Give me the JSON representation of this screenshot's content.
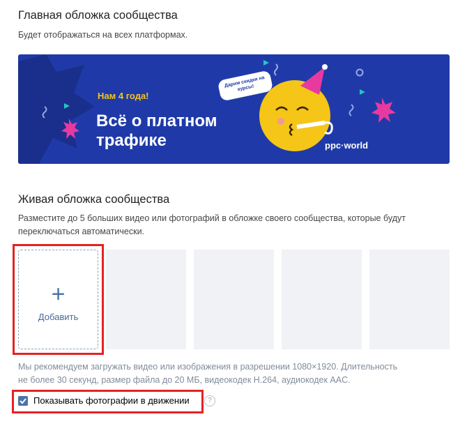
{
  "main_cover": {
    "title": "Главная обложка сообщества",
    "description": "Будет отображаться на всех платформах.",
    "banner": {
      "badge": "Нам 4 года!",
      "headline": "Всё о платном трафике",
      "sticker": "Дарим скидки на курсы!",
      "brand": "ppc·world",
      "colors": {
        "background": "#1f3aa8",
        "accent": "#f5c518",
        "pink": "#e73aa0"
      }
    }
  },
  "live_cover": {
    "title": "Живая обложка сообщества",
    "description_line1": "Разместите до 5 больших видео или фотографий в обложке своего сообщества, которые будут",
    "description_line2": "переключаться автоматически.",
    "add_label": "Добавить",
    "note_line1": "Мы рекомендуем загружать видео или изображения в разрешении 1080×1920. Длительность",
    "note_line2": "не более 30 секунд, размер файла до 20 МБ, видеокодек H.264, аудиокодек AAC.",
    "checkbox_label": "Показывать фотографии в движении",
    "checkbox_checked": true,
    "help_glyph": "?"
  },
  "colors": {
    "highlight": "#e52222",
    "link": "#4a76a8"
  }
}
